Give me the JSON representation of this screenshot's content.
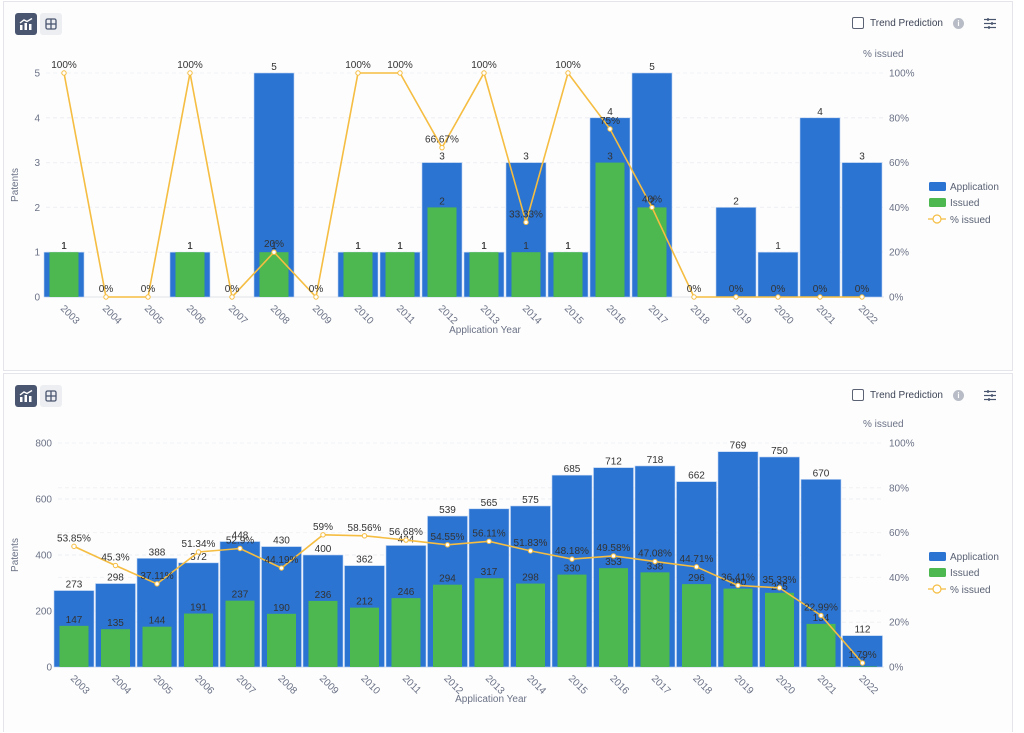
{
  "toolbar": {
    "chart_view_icon": "bar-line-chart-icon",
    "table_view_icon": "grid-table-icon",
    "trend_prediction_label": "Trend Prediction",
    "trend_prediction_checked": false,
    "info_icon": "info-icon",
    "settings_icon": "settings-sliders-icon"
  },
  "colors": {
    "application": "#2b74d2",
    "issued": "#4cb84f",
    "pct_line": "#f5bd41"
  },
  "chart_data": [
    {
      "type": "bar",
      "title": "",
      "xlabel": "Application Year",
      "ylabel": "Patents",
      "y2label": "% issued",
      "ylim": [
        0,
        5
      ],
      "yticks": [
        "0",
        "1",
        "2",
        "3",
        "4",
        "5"
      ],
      "y2lim": [
        0,
        100
      ],
      "y2ticks": [
        "0%",
        "20%",
        "40%",
        "60%",
        "80%",
        "100%"
      ],
      "grid": true,
      "legend_position": "right",
      "categories": [
        "2003",
        "2004",
        "2005",
        "2006",
        "2007",
        "2008",
        "2009",
        "2010",
        "2011",
        "2012",
        "2013",
        "2014",
        "2015",
        "2016",
        "2017",
        "2018",
        "2019",
        "2020",
        "2021",
        "2022"
      ],
      "series": [
        {
          "name": "Application",
          "kind": "bar",
          "values": [
            1,
            0,
            0,
            1,
            0,
            5,
            0,
            1,
            1,
            3,
            1,
            3,
            1,
            4,
            5,
            0,
            2,
            1,
            4,
            3
          ]
        },
        {
          "name": "Issued",
          "kind": "bar",
          "values": [
            1,
            0,
            0,
            1,
            0,
            1,
            0,
            1,
            1,
            2,
            1,
            1,
            1,
            3,
            2,
            0,
            0,
            0,
            0,
            0
          ]
        },
        {
          "name": "% issued",
          "kind": "line",
          "axis": "right",
          "values": [
            100,
            0,
            0,
            100,
            0,
            20,
            0,
            100,
            100,
            66.67,
            100,
            33.33,
            100,
            75,
            40,
            0,
            0,
            0,
            0,
            0
          ],
          "labels": [
            "100%",
            "0%",
            "0%",
            "100%",
            "0%",
            "20%",
            "0%",
            "100%",
            "100%",
            "66.67%",
            "100%",
            "33.33%",
            "100%",
            "75%",
            "40%",
            "0%",
            "0%",
            "0%",
            "0%",
            "0%"
          ]
        }
      ]
    },
    {
      "type": "bar",
      "title": "",
      "xlabel": "Application Year",
      "ylabel": "Patents",
      "y2label": "% issued",
      "ylim": [
        0,
        800
      ],
      "yticks": [
        "0",
        "200",
        "400",
        "600",
        "800"
      ],
      "y2lim": [
        0,
        100
      ],
      "y2ticks": [
        "0%",
        "20%",
        "40%",
        "60%",
        "80%",
        "100%"
      ],
      "grid": true,
      "legend_position": "right",
      "categories": [
        "2003",
        "2004",
        "2005",
        "2006",
        "2007",
        "2008",
        "2009",
        "2010",
        "2011",
        "2012",
        "2013",
        "2014",
        "2015",
        "2016",
        "2017",
        "2018",
        "2019",
        "2020",
        "2021",
        "2022"
      ],
      "series": [
        {
          "name": "Application",
          "kind": "bar",
          "values": [
            273,
            298,
            388,
            372,
            448,
            430,
            400,
            362,
            434,
            539,
            565,
            575,
            685,
            712,
            718,
            662,
            769,
            750,
            670,
            112
          ]
        },
        {
          "name": "Issued",
          "kind": "bar",
          "values": [
            147,
            135,
            144,
            191,
            237,
            190,
            236,
            212,
            246,
            294,
            317,
            298,
            330,
            353,
            338,
            296,
            280,
            265,
            154,
            2
          ]
        },
        {
          "name": "% issued",
          "kind": "line",
          "axis": "right",
          "values": [
            53.85,
            45.3,
            37.11,
            51.34,
            52.9,
            44.19,
            59,
            58.56,
            56.68,
            54.55,
            56.11,
            51.83,
            48.18,
            49.58,
            47.08,
            44.71,
            36.41,
            35.33,
            22.99,
            1.79
          ],
          "labels": [
            "53.85%",
            "45.3%",
            "37.11%",
            "51.34%",
            "52.9%",
            "44.19%",
            "59%",
            "58.56%",
            "56.68%",
            "54.55%",
            "56.11%",
            "51.83%",
            "48.18%",
            "49.58%",
            "47.08%",
            "44.71%",
            "36.41%",
            "35.33%",
            "22.99%",
            "1.79%"
          ]
        }
      ]
    }
  ]
}
